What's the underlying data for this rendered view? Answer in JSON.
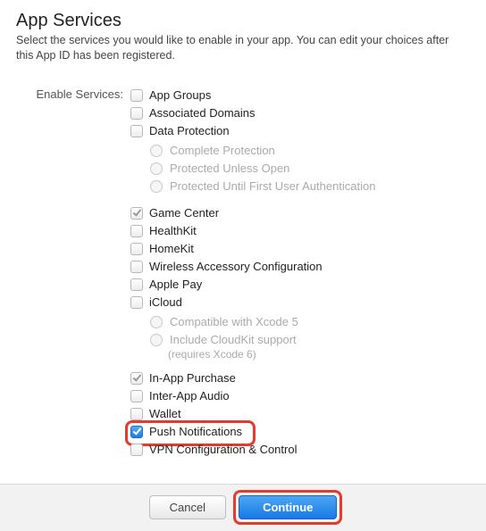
{
  "header": {
    "title": "App Services",
    "subtitle": "Select the services you would like to enable in your app. You can edit your choices after this App ID has been registered."
  },
  "form": {
    "label": "Enable Services:"
  },
  "services": {
    "app_groups": "App Groups",
    "associated_domains": "Associated Domains",
    "data_protection": "Data Protection",
    "dp_complete": "Complete Protection",
    "dp_unless_open": "Protected Unless Open",
    "dp_until_first_auth": "Protected Until First User Authentication",
    "game_center": "Game Center",
    "healthkit": "HealthKit",
    "homekit": "HomeKit",
    "wireless_accessory": "Wireless Accessory Configuration",
    "apple_pay": "Apple Pay",
    "icloud": "iCloud",
    "icloud_xcode5": "Compatible with Xcode 5",
    "icloud_cloudkit": "Include CloudKit support",
    "icloud_cloudkit_note": "(requires Xcode 6)",
    "iap": "In-App Purchase",
    "inter_app_audio": "Inter-App Audio",
    "wallet": "Wallet",
    "push": "Push Notifications",
    "vpn": "VPN Configuration & Control"
  },
  "buttons": {
    "cancel": "Cancel",
    "continue": "Continue"
  }
}
